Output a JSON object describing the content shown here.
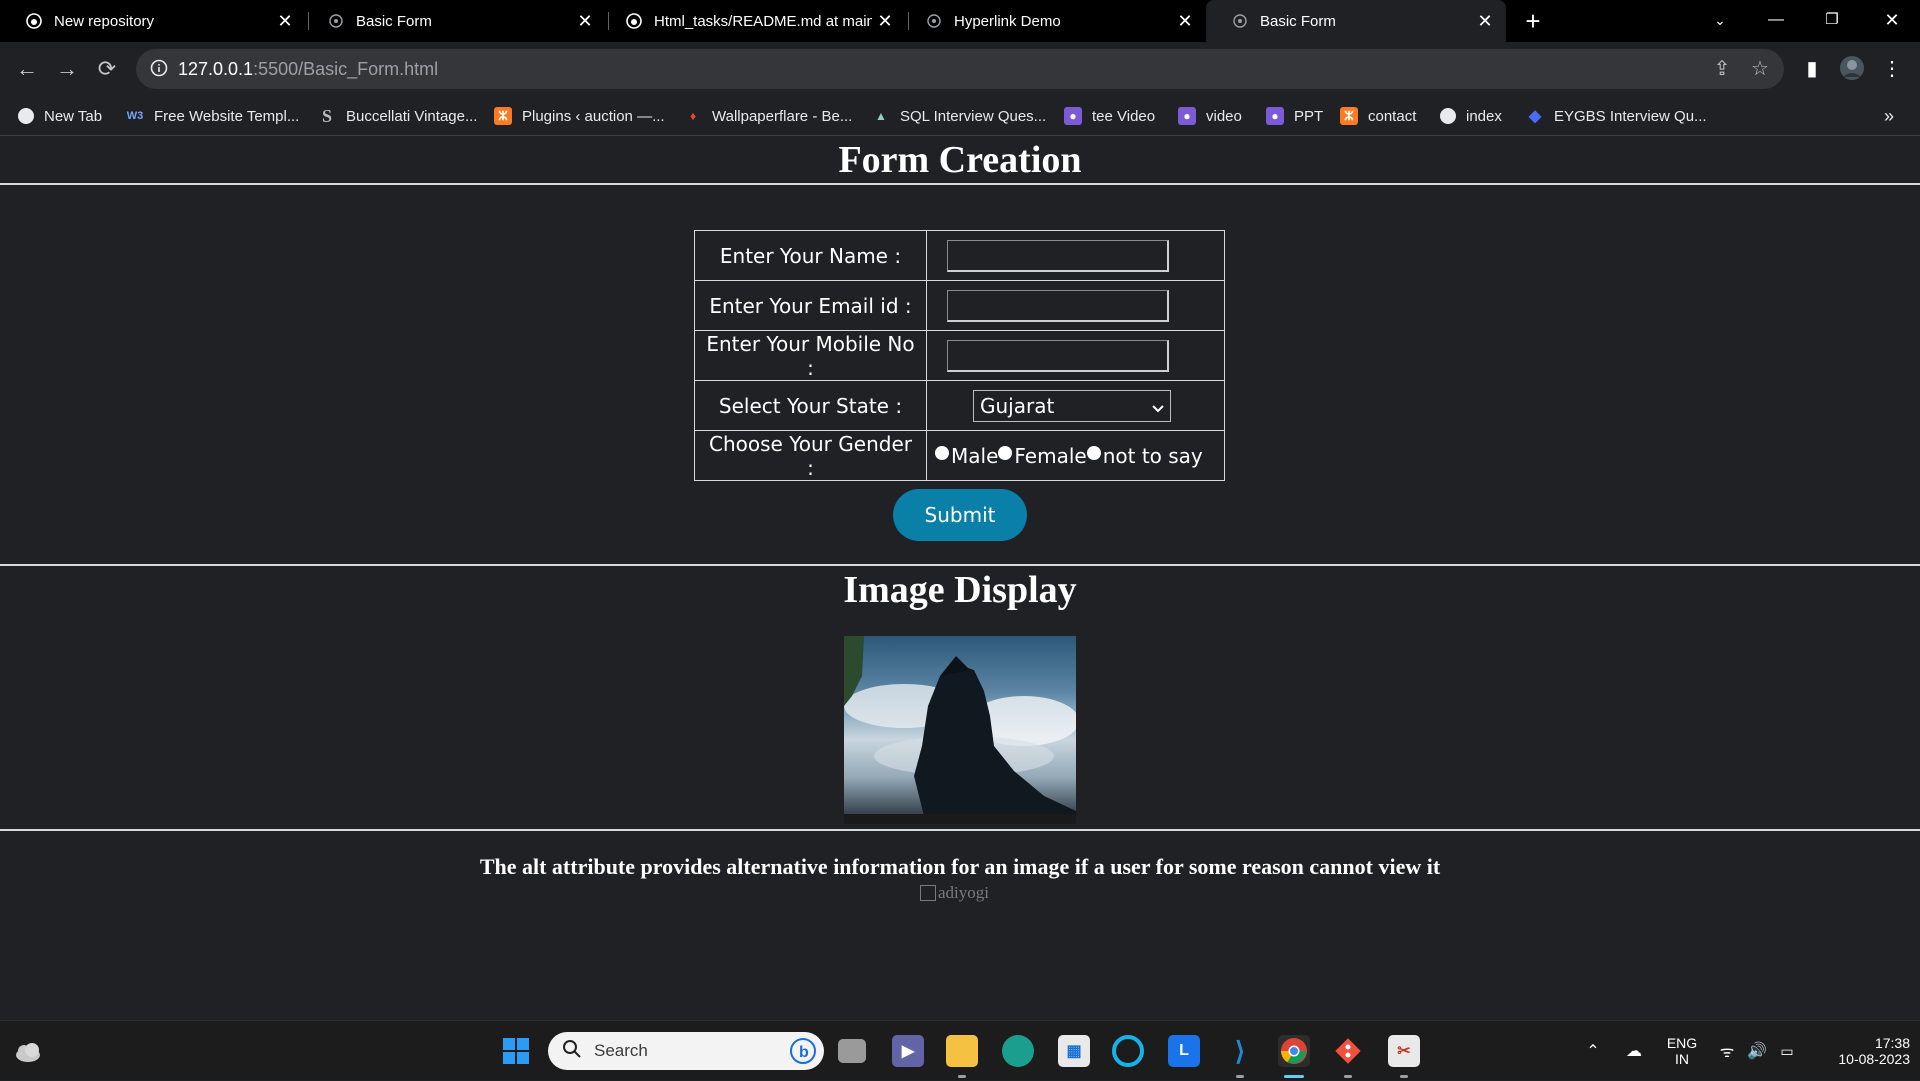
{
  "tabs": [
    {
      "title": "New repository",
      "icon": "github-icon",
      "active": false
    },
    {
      "title": "Basic Form",
      "icon": "globe-icon",
      "active": false
    },
    {
      "title": "Html_tasks/README.md at main",
      "icon": "github-icon",
      "active": false
    },
    {
      "title": "Hyperlink Demo",
      "icon": "globe-icon",
      "active": false
    },
    {
      "title": "Basic Form",
      "icon": "globe-icon",
      "active": true
    }
  ],
  "toolbar": {
    "url_host": "127.0.0.1",
    "url_rest": ":5500/Basic_Form.html"
  },
  "bookmarks": [
    {
      "label": "New Tab",
      "icon": "globe-icon"
    },
    {
      "label": "Free Website Templ...",
      "icon": "w3-icon"
    },
    {
      "label": "Buccellati Vintage...",
      "icon": "s-icon"
    },
    {
      "label": "Plugins ‹ auction —...",
      "icon": "xampp-icon"
    },
    {
      "label": "Wallpaperflare - Be...",
      "icon": "flame-icon"
    },
    {
      "label": "SQL Interview Ques...",
      "icon": "mountain-icon"
    },
    {
      "label": "tee Video",
      "icon": "video-icon"
    },
    {
      "label": "video",
      "icon": "video-icon"
    },
    {
      "label": "PPT",
      "icon": "video-icon"
    },
    {
      "label": "contact",
      "icon": "xampp-icon"
    },
    {
      "label": "index",
      "icon": "globe-icon"
    },
    {
      "label": "EYGBS Interview Qu...",
      "icon": "diamond-icon"
    }
  ],
  "page": {
    "form_heading": "Form Creation",
    "rows": {
      "name_label": "Enter Your Name :",
      "email_label": "Enter Your Email id :",
      "mobile_label": "Enter Your Mobile No :",
      "state_label": "Select Your State :",
      "gender_label": "Choose Your Gender :"
    },
    "fields": {
      "name_value": "",
      "email_value": "",
      "mobile_value": "",
      "state_selected": "Gujarat"
    },
    "gender_options": [
      "Male",
      "Female",
      "not to say"
    ],
    "submit_label": "Submit",
    "image_heading": "Image Display",
    "alt_paragraph": "The alt attribute provides alternative information for an image if a user for some reason cannot view it",
    "broken_alt": "adiyogi"
  },
  "taskbar": {
    "search_label": "Search",
    "lang_top": "ENG",
    "lang_bottom": "IN",
    "time": "17:38",
    "date": "10-08-2023"
  }
}
